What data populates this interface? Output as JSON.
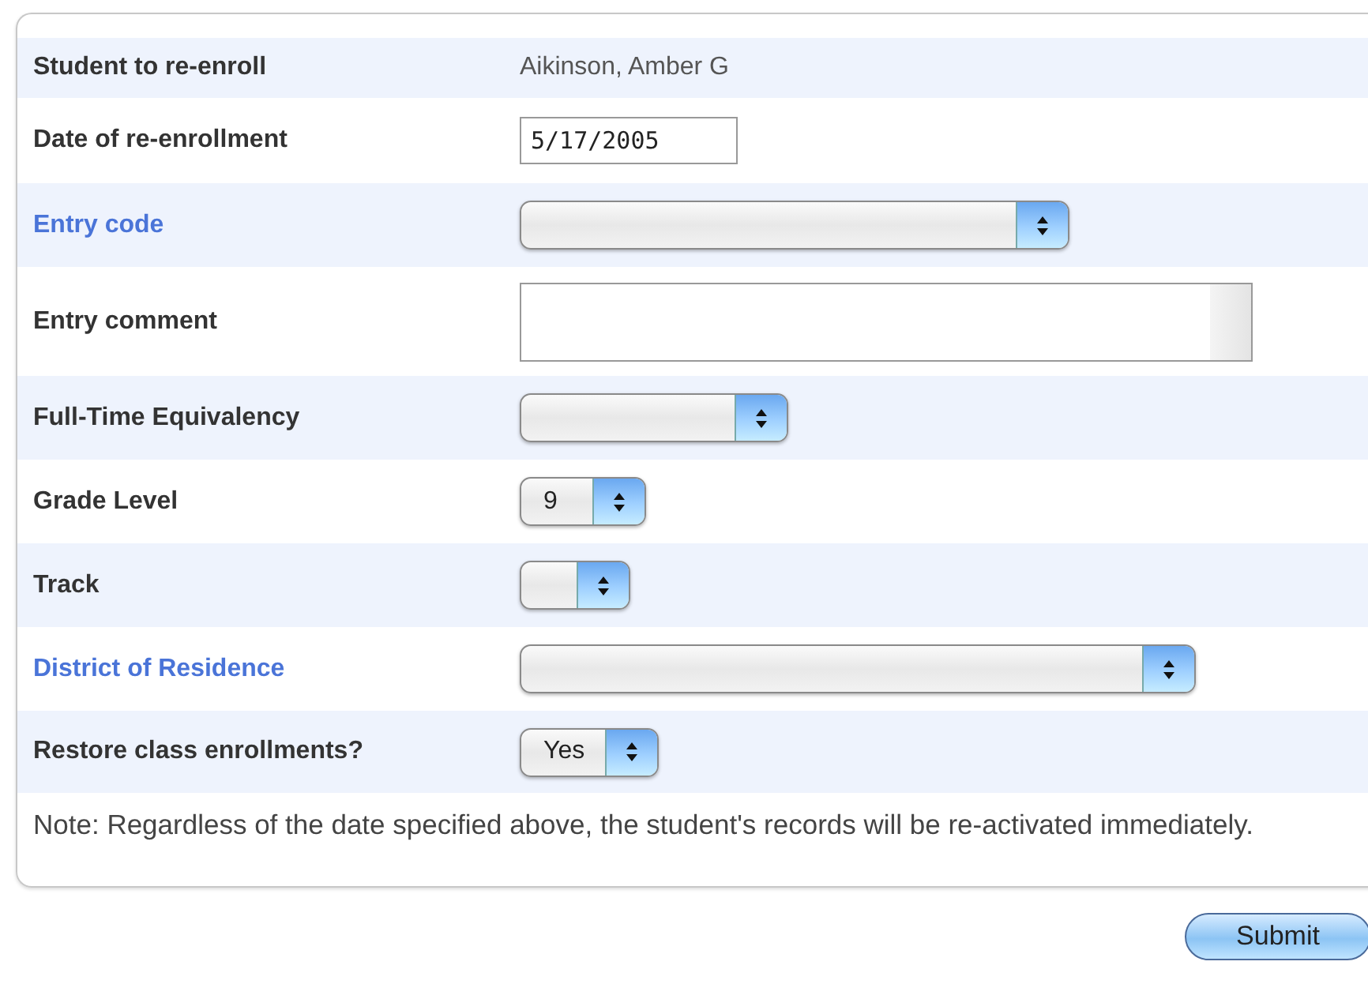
{
  "rows": [
    {
      "label": "Student to re-enroll",
      "link": false,
      "kind": "text",
      "value": "Aikinson, Amber G"
    },
    {
      "label": "Date of re-enrollment",
      "link": false,
      "kind": "input",
      "value": "5/17/2005"
    },
    {
      "label": "Entry code",
      "link": true,
      "kind": "select"
    },
    {
      "label": "Entry comment",
      "link": false,
      "kind": "textarea"
    },
    {
      "label": "Full-Time Equivalency",
      "link": false,
      "kind": "select"
    },
    {
      "label": "Grade Level",
      "link": false,
      "kind": "select",
      "value": "9"
    },
    {
      "label": "Track",
      "link": false,
      "kind": "select"
    },
    {
      "label": "District of Residence",
      "link": true,
      "kind": "select"
    },
    {
      "label": "Restore class enrollments?",
      "link": false,
      "kind": "select",
      "value": "Yes"
    }
  ],
  "note": "Note: Regardless of the date specified above, the student's records will be re-activated immediately.",
  "submit": "Submit"
}
